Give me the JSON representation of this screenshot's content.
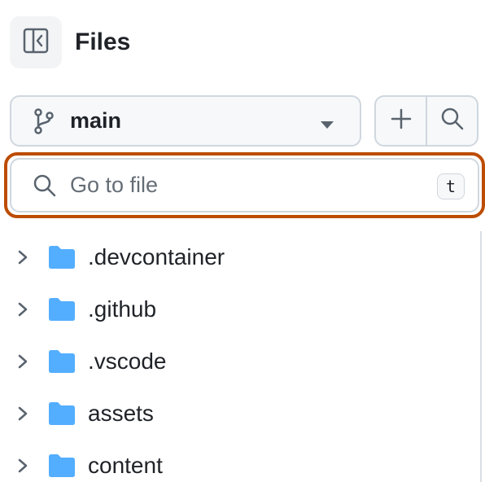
{
  "header": {
    "title": "Files",
    "collapse_icon": "sidebar-collapse-icon"
  },
  "branch": {
    "name": "main",
    "icon": "git-branch-icon",
    "caret_icon": "triangle-down-icon"
  },
  "actions": {
    "add_icon": "plus-icon",
    "search_icon": "search-icon"
  },
  "search": {
    "placeholder": "Go to file",
    "value": "",
    "shortcut": "t",
    "focus_ring_color": "#bc4c00"
  },
  "tree": {
    "folder_color": "#54aeff",
    "items": [
      {
        "label": ".devcontainer",
        "type": "folder"
      },
      {
        "label": ".github",
        "type": "folder"
      },
      {
        "label": ".vscode",
        "type": "folder"
      },
      {
        "label": "assets",
        "type": "folder"
      },
      {
        "label": "content",
        "type": "folder"
      }
    ]
  }
}
